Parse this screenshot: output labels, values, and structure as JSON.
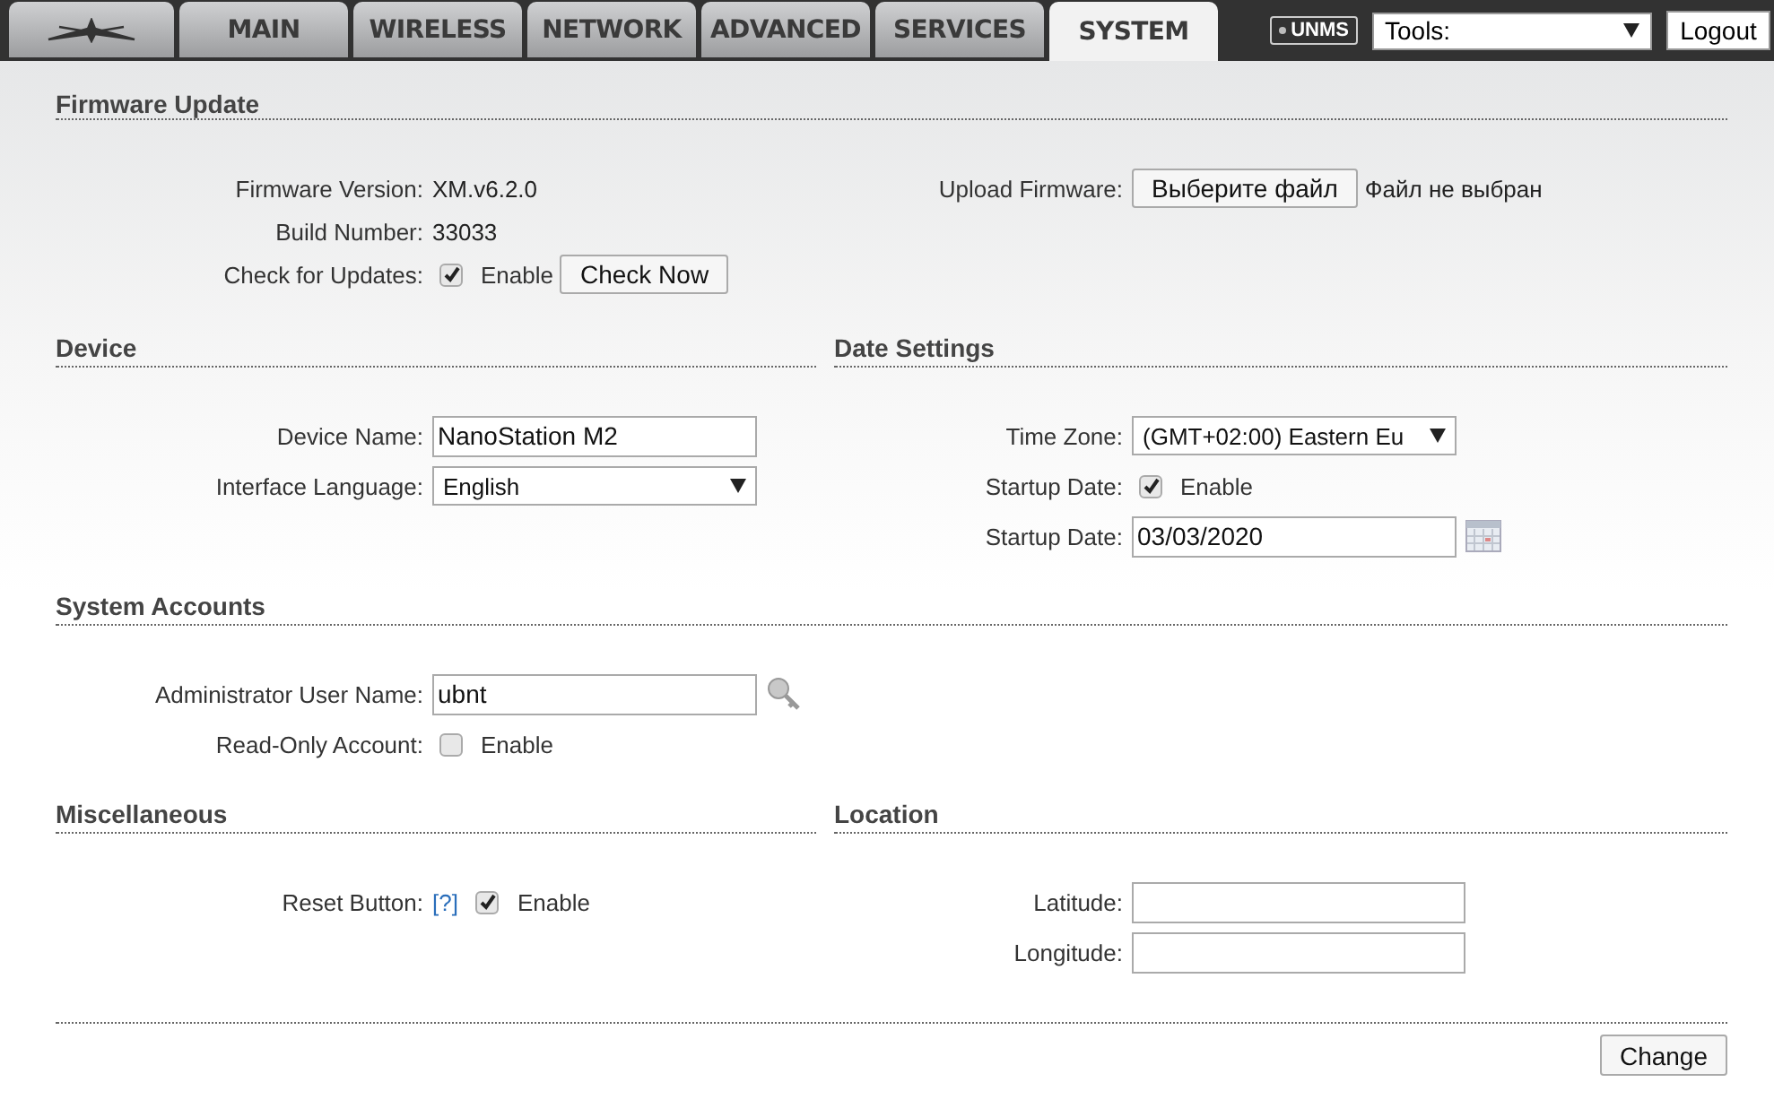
{
  "tabs": [
    {
      "kind": "logo",
      "selected": false
    },
    {
      "kind": "text",
      "label": "MAIN",
      "selected": false
    },
    {
      "kind": "text",
      "label": "WIRELESS",
      "selected": false
    },
    {
      "kind": "text",
      "label": "NETWORK",
      "selected": false
    },
    {
      "kind": "text",
      "label": "ADVANCED",
      "selected": false
    },
    {
      "kind": "text",
      "label": "SERVICES",
      "selected": false
    },
    {
      "kind": "text",
      "label": "SYSTEM",
      "selected": true
    }
  ],
  "toolbar": {
    "badge": "UNMS",
    "tools": "Tools:",
    "logout": "Logout"
  },
  "bands": [
    {
      "groups": [
        {
          "title": "Firmware Update",
          "columns": [
            [
              {
                "kind": "text",
                "label": "Firmware Version:",
                "value": "XM.v6.2.0"
              },
              {
                "kind": "text",
                "label": "Build Number:",
                "value": "33033"
              },
              {
                "kind": "checkbox",
                "label": "Check for Updates:",
                "checked": true,
                "option": "Enable",
                "button": "Check Now"
              }
            ],
            [
              {
                "kind": "file",
                "label": "Upload Firmware:",
                "button": "Выберите файл",
                "status": "Файл не выбран"
              }
            ]
          ]
        }
      ]
    },
    {
      "groups": [
        {
          "title": "Device",
          "columns": [
            [
              {
                "kind": "input",
                "label": "Device Name:",
                "value": "NanoStation M2"
              },
              {
                "kind": "select",
                "label": "Interface Language:",
                "value": "English"
              }
            ]
          ]
        },
        {
          "title": "Date Settings",
          "columns": [
            [
              {
                "kind": "select",
                "label": "Time Zone:",
                "value": "(GMT+02:00) Eastern Eu"
              },
              {
                "kind": "checkbox",
                "label": "Startup Date:",
                "checked": true,
                "option": "Enable"
              },
              {
                "kind": "date",
                "label": "Startup Date:",
                "value": "03/03/2020"
              }
            ]
          ]
        }
      ]
    },
    {
      "groups": [
        {
          "title": "System Accounts",
          "columns": [
            [
              {
                "kind": "key",
                "label": "Administrator User Name:",
                "value": "ubnt"
              },
              {
                "kind": "checkbox",
                "label": "Read-Only Account:",
                "checked": false,
                "option": "Enable"
              }
            ]
          ]
        }
      ]
    },
    {
      "groups": [
        {
          "title": "Miscellaneous",
          "columns": [
            [
              {
                "kind": "checkbox",
                "label": "Reset Button:",
                "help": "[?]",
                "checked": true,
                "option": "Enable"
              }
            ]
          ]
        },
        {
          "title": "Location",
          "columns": [
            [
              {
                "kind": "input",
                "label": "Latitude:"
              },
              {
                "kind": "input",
                "label": "Longitude:"
              }
            ]
          ]
        }
      ]
    }
  ],
  "change_button": "Change"
}
